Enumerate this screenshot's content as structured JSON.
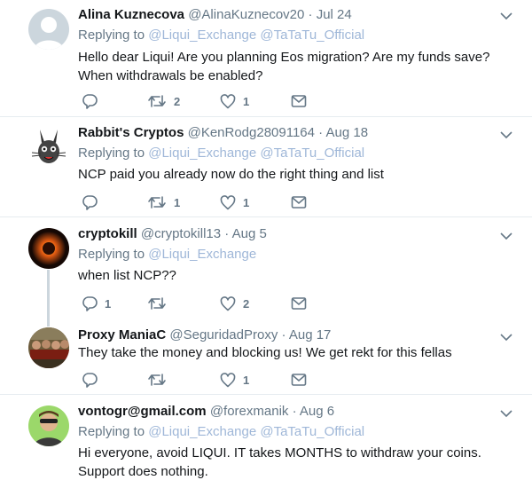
{
  "tweets": [
    {
      "name": "Alina Kuznecova",
      "handle": "@AlinaKuznecov20",
      "date": "Jul 24",
      "replying_prefix": "Replying to",
      "mentions": "@Liqui_Exchange @TaTaTu_Official",
      "text": "Hello dear Liqui! Are you planning Eos migration? Are my funds save? When withdrawals be enabled?",
      "reply_count": "",
      "retweet_count": "2",
      "like_count": "1",
      "avatar_icon": "default-avatar-icon"
    },
    {
      "name": "Rabbit's Cryptos",
      "handle": "@KenRodg28091164",
      "date": "Aug 18",
      "replying_prefix": "Replying to",
      "mentions": "@Liqui_Exchange @TaTaTu_Official",
      "text": "NCP paid you already now do the right thing and list",
      "reply_count": "",
      "retweet_count": "1",
      "like_count": "1",
      "avatar_icon": "rabbit-avatar-icon"
    },
    {
      "name": "cryptokill",
      "handle": "@cryptokill13",
      "date": "Aug 5",
      "replying_prefix": "Replying to",
      "mentions": "@Liqui_Exchange",
      "text": "when list NCP??",
      "reply_count": "1",
      "retweet_count": "",
      "like_count": "2",
      "avatar_icon": "fire-avatar-icon"
    },
    {
      "name": "Proxy ManiaC",
      "handle": "@SeguridadProxy",
      "date": "Aug 17",
      "replying_prefix": "",
      "mentions": "",
      "text": "They take the money and blocking us! We get rekt for this fellas",
      "reply_count": "",
      "retweet_count": "",
      "like_count": "1",
      "avatar_icon": "group-photo-avatar-icon"
    },
    {
      "name": "vontogr@gmail.com",
      "handle": "@forexmanik",
      "date": "Aug 6",
      "replying_prefix": "Replying to",
      "mentions": "@Liqui_Exchange @TaTaTu_Official",
      "text": "Hi everyone, avoid LIQUI. IT takes MONTHS to withdraw your coins. Support does nothing.",
      "reply_count": "",
      "retweet_count": "",
      "like_count": "",
      "avatar_icon": "person-sunglasses-avatar-icon"
    }
  ],
  "separator": "·",
  "colors": {
    "link": "#9fb7d8",
    "muted": "#657786",
    "text": "#14171a",
    "divider": "#e6ecf0"
  }
}
